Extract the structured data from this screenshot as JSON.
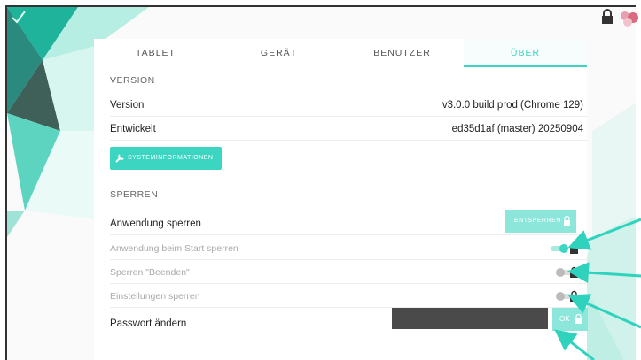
{
  "tabs": [
    {
      "label": "TABLET"
    },
    {
      "label": "GERÄT"
    },
    {
      "label": "BENUTZER"
    },
    {
      "label": "ÜBER"
    }
  ],
  "version_section": {
    "heading": "VERSION",
    "rows": [
      {
        "label": "Version",
        "value": "v3.0.0 build prod (Chrome 129)"
      },
      {
        "label": "Entwickelt",
        "value": "ed35d1af (master) 20250904"
      }
    ],
    "sysinfo_button": "SYSTEMINFORMATIONEN"
  },
  "lock_section": {
    "heading": "SPERREN",
    "lock_app": {
      "label": "Anwendung sperren",
      "button": "ENTSPERREN"
    },
    "lock_on_start": {
      "label": "Anwendung beim Start sperren",
      "on": true
    },
    "lock_quit": {
      "label": "Sperren \"Beenden\"",
      "on": false
    },
    "lock_settings": {
      "label": "Einstellungen sperren",
      "on": false
    },
    "change_password": {
      "label": "Passwort ändern",
      "ok_button": "OK"
    }
  },
  "colors": {
    "accent": "#3cd5c1",
    "accent_light": "#8de6da"
  },
  "icons": [
    "check-icon",
    "lock-icon",
    "avatar-icon",
    "wrench-icon",
    "toggle-icon",
    "arrow-icon"
  ]
}
